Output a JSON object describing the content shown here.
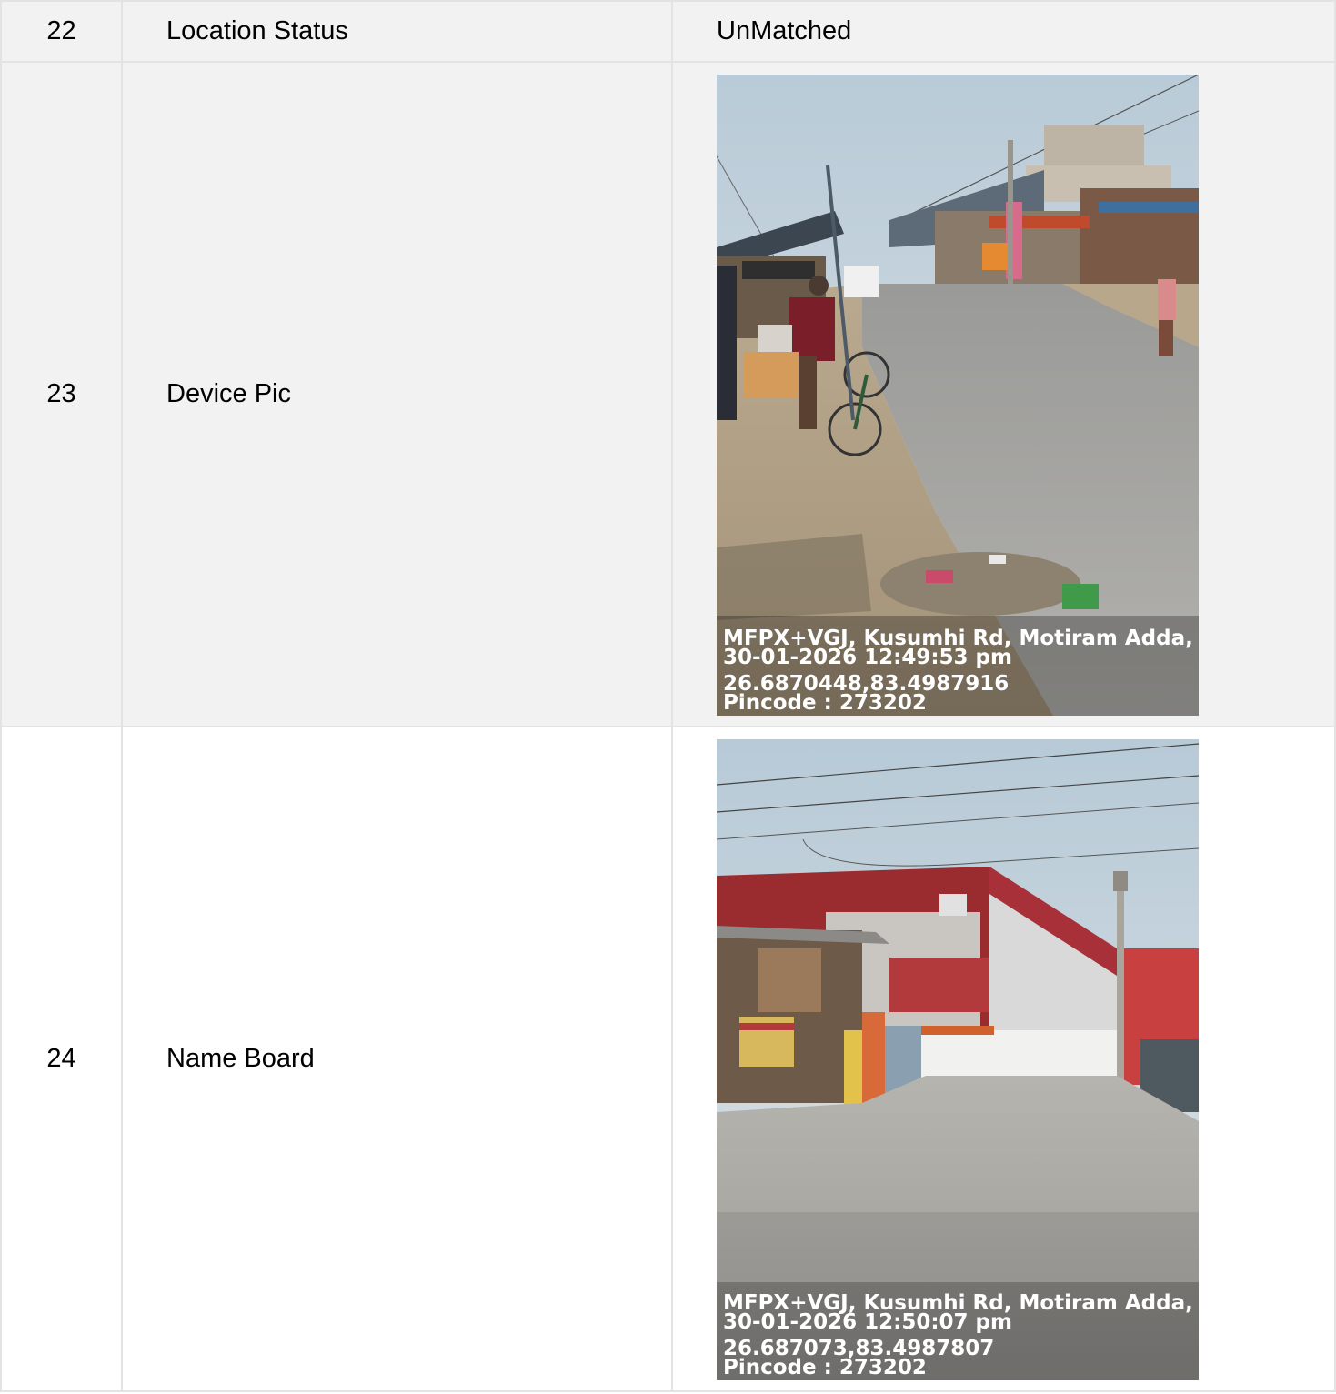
{
  "rows": [
    {
      "no": "22",
      "field": "Location Status",
      "value": "UnMatched"
    },
    {
      "no": "23",
      "field": "Device Pic",
      "photo": {
        "line1": "MFPX+VGJ, Kusumhi Rd, Motiram Adda, Utta",
        "line2": "30-01-2026 12:49:53 pm",
        "line3": "26.6870448,83.4987916",
        "line4": "Pincode : 273202"
      }
    },
    {
      "no": "24",
      "field": "Name Board",
      "photo": {
        "line1": "MFPX+VGJ, Kusumhi Rd, Motiram Adda, Utta",
        "line2": "30-01-2026 12:50:07 pm",
        "line3": "26.687073,83.4987807",
        "line4": "Pincode : 273202"
      }
    }
  ]
}
